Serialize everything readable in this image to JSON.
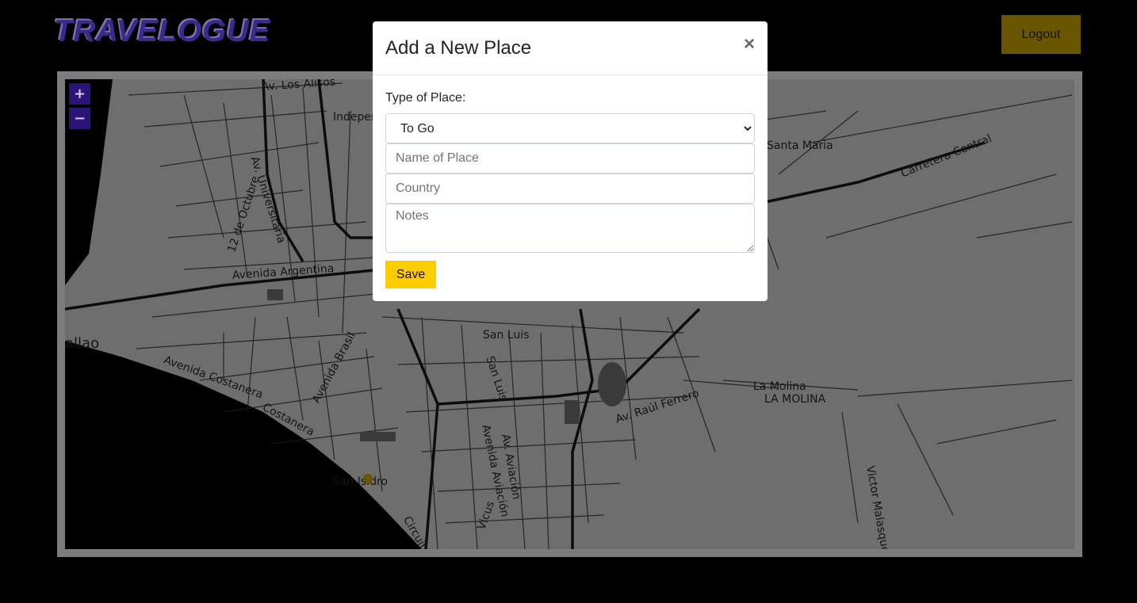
{
  "header": {
    "brand": "TRAVELOGUE",
    "logout_label": "Logout"
  },
  "map": {
    "zoom_in": "+",
    "zoom_out": "−",
    "labels": {
      "los_alisos": "Av. Los Alisos",
      "indep": "Indeper",
      "universitaria": "Av. Universitaria",
      "octubre": "12 de Octubre",
      "argentina": "Avenida Argentina",
      "santa_maria": "Santa Maria",
      "carretera": "Carretera Central",
      "callao": "allao",
      "costanera_av": "Avenida Costanera",
      "costanera": "Costanera",
      "brasil": "Avenida Brasil",
      "san_luis": "San Luis",
      "san_luis_road": "San Luis",
      "aviacion": "Av. Aviación",
      "aviacion2": "Avenida Aviación",
      "raul_ferrero": "Av. Raúl Ferrero",
      "la_molina": "La Molina",
      "la_molina_caps": "LA MOLINA",
      "victor": "Victor Malasquez",
      "san_isidro": "San Isidro",
      "circuito": "Circuito",
      "vicus": "Vicus"
    }
  },
  "modal": {
    "title": "Add a New Place",
    "close": "×",
    "type_label": "Type of Place:",
    "type_value": "To Go",
    "name_placeholder": "Name of Place",
    "country_placeholder": "Country",
    "notes_placeholder": "Notes",
    "save_label": "Save"
  }
}
